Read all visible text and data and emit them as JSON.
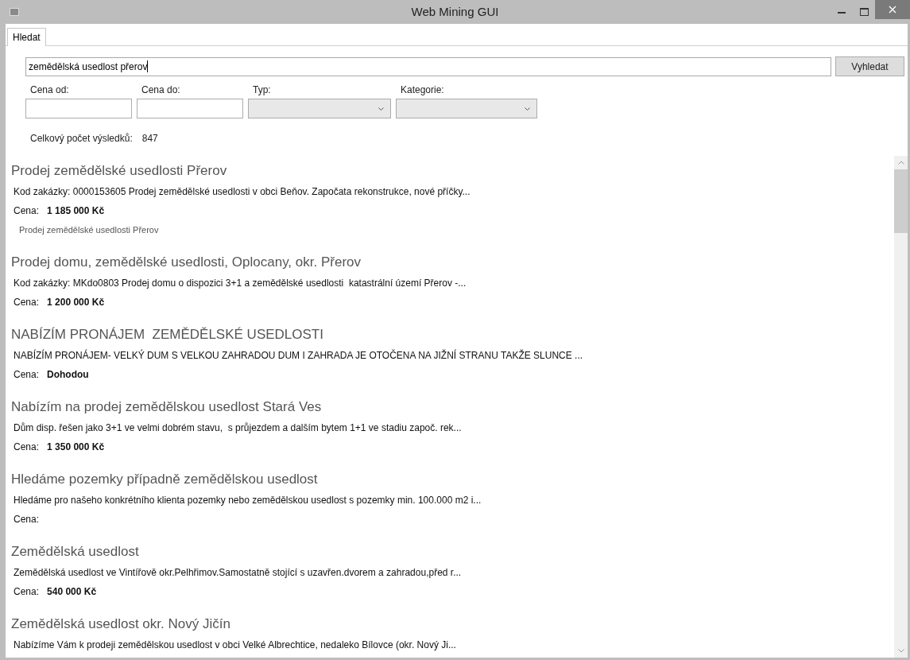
{
  "window": {
    "title": "Web Mining GUI"
  },
  "tabs": [
    {
      "label": "Hledat",
      "selected": true
    }
  ],
  "search": {
    "value": "zemědělská usedlost přerov",
    "button": "Vyhledat"
  },
  "filters": [
    {
      "kind": "text",
      "label": "Cena od:"
    },
    {
      "kind": "text",
      "label": "Cena do:"
    },
    {
      "kind": "select",
      "label": "Typ:"
    },
    {
      "kind": "select",
      "label": "Kategorie:"
    }
  ],
  "total": {
    "label": "Celkový počet výsledků:",
    "value": "847"
  },
  "results": [
    {
      "title": "Prodej zemědělské usedlosti Přerov",
      "description": "Kod zakázky: 0000153605 Prodej zemědělské usedlosti v obci Beňov. Započata rekonstrukce, nové příčky...",
      "price_label": "Cena:",
      "price": "1 185 000 Kč",
      "subtitle": "Prodej zemědělské usedlosti Přerov"
    },
    {
      "title": "Prodej domu, zemědělské usedlosti, Oplocany, okr. Přerov",
      "description": "Kod zakázky: MKdo0803 Prodej domu o dispozici 3+1 a zemědělské usedlosti  katastrální území Přerov -...",
      "price_label": "Cena:",
      "price": "1 200 000 Kč"
    },
    {
      "title": "NABÍZÍM PRONÁJEM  ZEMĚDĚLSKÉ USEDLOSTI",
      "description": "NABÍZÍM PRONÁJEM- VELKÝ DUM S VELKOU ZAHRADOU DUM I ZAHRADA JE OTOČENA NA JIŽNÍ STRANU TAKŽE SLUNCE ...",
      "price_label": "Cena:",
      "price": "Dohodou"
    },
    {
      "title": "Nabízím na prodej zemědělskou usedlost Stará Ves",
      "description": "Dům disp. řešen jako 3+1 ve velmi dobrém stavu,  s průjezdem a dalším bytem 1+1 ve stadiu započ. rek...",
      "price_label": "Cena:",
      "price": "1 350 000 Kč"
    },
    {
      "title": "Hledáme pozemky případně zemědělskou usedlost",
      "description": "Hledáme pro našeho konkrétního klienta pozemky nebo zemědělskou usedlost s pozemky min. 100.000 m2 i...",
      "price_label": "Cena:"
    },
    {
      "title": "Zemědělská usedlost",
      "description": "Zemědělská usedlost ve Vintířově okr.Pelhřimov.Samostatně stojící s uzavřen.dvorem a zahradou,před r...",
      "price_label": "Cena:",
      "price": "540 000 Kč"
    },
    {
      "title": "Zemědělská usedlost okr. Nový Jičín",
      "description": "Nabízíme Vám k prodeji zemědělskou usedlost v obci Velké Albrechtice, nedaleko Bílovce (okr. Nový Ji..."
    }
  ]
}
